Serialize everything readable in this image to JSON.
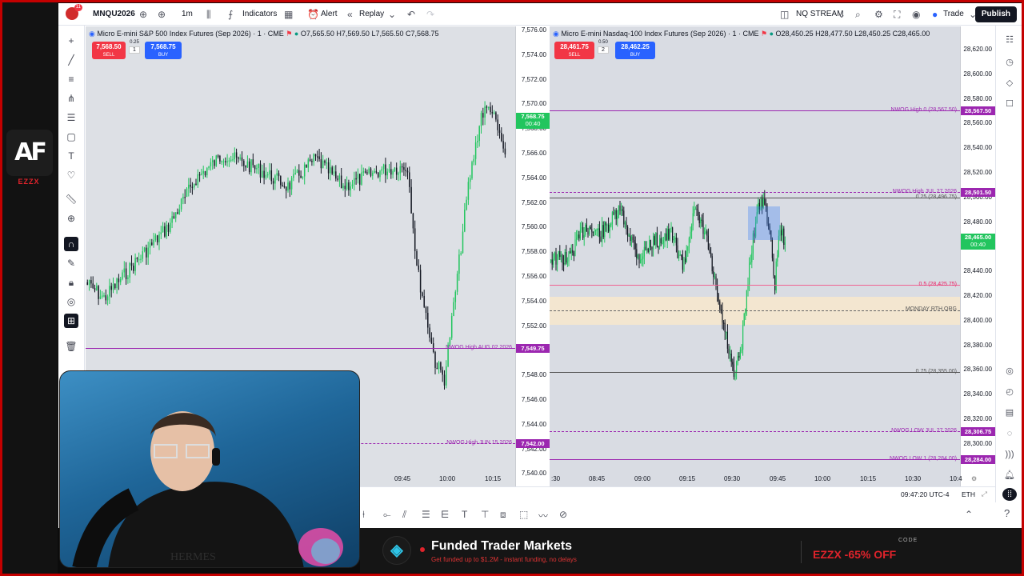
{
  "brand": {
    "logo_text": "AF",
    "tag": "EZZX"
  },
  "topbar": {
    "notifications": "11",
    "symbol": "MNQU2026",
    "interval": "1m",
    "indicators": "Indicators",
    "alert": "Alert",
    "replay": "Replay",
    "layout_name": "NQ STREAM",
    "trade": "Trade",
    "publish": "Publish"
  },
  "chart_left": {
    "title": "Micro E-mini S&P 500 Index Futures (Sep 2026) · 1 · CME",
    "ohlc": "O7,565.50 H7,569.50 L7,565.50 C7,568.75",
    "sell": {
      "price": "7,568.50",
      "label": "SELL"
    },
    "spread": {
      "value": "0.25",
      "qty": "1"
    },
    "buy": {
      "price": "7,568.75",
      "label": "BUY"
    },
    "axis_ticks": [
      "7,576.00",
      "7,574.00",
      "7,572.00",
      "7,570.00",
      "7,568.00",
      "7,566.00",
      "7,564.00",
      "7,562.00",
      "7,560.00",
      "7,558.00",
      "7,556.00",
      "7,554.00",
      "7,552.00",
      "7,550.00",
      "7,548.00",
      "7,546.00",
      "7,544.00",
      "7,542.00",
      "7,540.00"
    ],
    "last_price": "7,568.75",
    "last_timer": "00:40",
    "level1": {
      "label": "NWOG High AUG 02.2026",
      "price": "7,549.75"
    },
    "level2": {
      "label": "NWOG High JUN 15.2026",
      "price": "7,542.00"
    },
    "time_ticks": [
      "09:45",
      "10:00",
      "10:15"
    ]
  },
  "chart_right": {
    "title": "Micro E-mini Nasdaq-100 Index Futures (Sep 2026) · 1 · CME",
    "ohlc": "O28,450.25 H28,477.50 L28,450.25 C28,465.00",
    "sell": {
      "price": "28,461.75",
      "label": "SELL"
    },
    "spread": {
      "value": "0.50",
      "qty": "2"
    },
    "buy": {
      "price": "28,462.25",
      "label": "BUY"
    },
    "axis_ticks": [
      "28,620.00",
      "28,600.00",
      "28,580.00",
      "28,560.00",
      "28,540.00",
      "28,520.00",
      "28,500.00",
      "28,480.00",
      "28,460.00",
      "28,440.00",
      "28,420.00",
      "28,400.00",
      "28,380.00",
      "28,360.00",
      "28,340.00",
      "28,320.00",
      "28,300.00"
    ],
    "last_price": "28,465.00",
    "last_timer": "00:40",
    "lvl_high_aug": {
      "label": "NWOG High 0 (28,567.50)",
      "price": "28,567.50"
    },
    "lvl_high_jul": {
      "label": "NWOG High JUL 27.2026",
      "price": "28,501.50"
    },
    "fib_025": "0.25 (28,496.75)",
    "fib_05": "0.5 (28,425.75)",
    "monday": "MONDAY RTH ORG",
    "fib_075": "0.75 (28,355.00)",
    "lvl_low_jul": {
      "label": "NWOG LOW JUL 27.2026",
      "price": "28,306.75"
    },
    "lvl_low2": {
      "label": "NWOG LOW 1 (28,284.00)",
      "price": "28,284.00"
    },
    "time_ticks": [
      ":30",
      "08:45",
      "09:00",
      "09:15",
      "09:30",
      "09:45",
      "10:00",
      "10:15",
      "10:30",
      "10:4"
    ]
  },
  "status": {
    "clock": "09:47:20 UTC-4",
    "session": "ETH"
  },
  "banner": {
    "title": "Funded Trader Markets",
    "subtitle": "Get funded up to $1.2M - instant funding, no delays",
    "code_label": "CODE",
    "offer": "EZZX -65% OFF"
  },
  "colors": {
    "up": "#26a69a",
    "up_bright": "#22c55e",
    "down": "#131722",
    "level": "#9c27b0",
    "sell": "#f23645",
    "buy": "#2962ff",
    "frame": "#c40000"
  }
}
